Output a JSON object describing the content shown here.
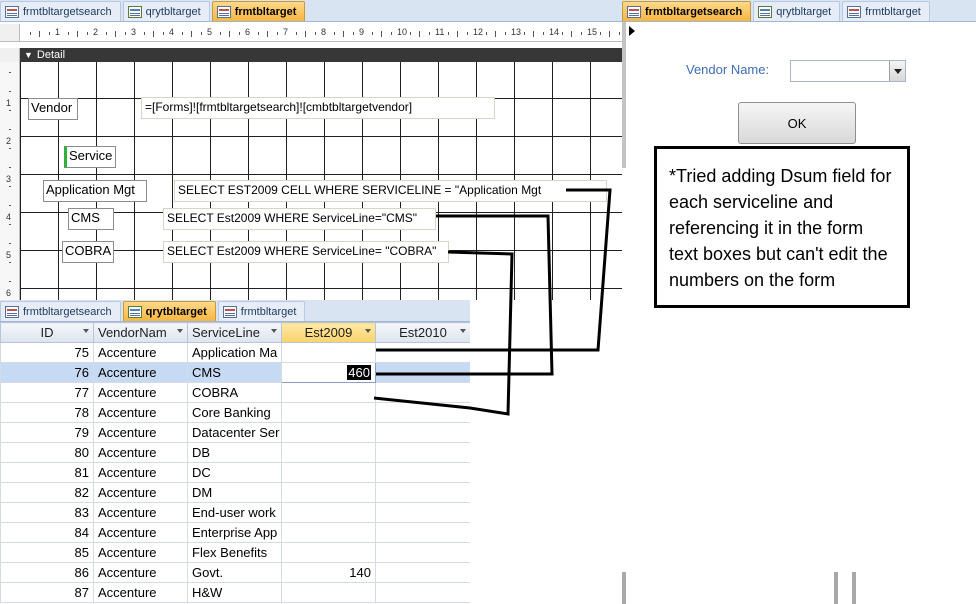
{
  "design_view": {
    "tabs": [
      {
        "label": "frmtbltargetsearch",
        "active": false
      },
      {
        "label": "qrytbltarget",
        "active": false
      },
      {
        "label": "frmtbltarget",
        "active": true
      }
    ],
    "section_label": "Detail",
    "ruler_numbers": [
      "1",
      "2",
      "3",
      "4",
      "5",
      "6",
      "7",
      "8",
      "9",
      "10",
      "11",
      "12",
      "13",
      "14",
      "15"
    ],
    "vertical_ruler_numbers": [
      "1",
      "2",
      "3",
      "4",
      "5",
      "6"
    ],
    "labels": {
      "vendor": "Vendor",
      "service": "Service",
      "application_mgt": "Application Mgt",
      "cms": "CMS",
      "cobra": "COBRA"
    },
    "textboxes": {
      "vendor_expr": "=[Forms]![frmtbltargetsearch]![cmbtbltargetvendor]",
      "application_mgt_query": "SELECT EST2009 CELL WHERE SERVICELINE = \"Application Mgt",
      "cms_query": "SELECT Est2009 WHERE ServiceLine=\"CMS\"",
      "cobra_query": "SELECT Est2009 WHERE ServiceLine= \"COBRA\""
    }
  },
  "datasheet": {
    "tabs": [
      {
        "label": "frmtbltargetsearch",
        "active": false
      },
      {
        "label": "qrytbltarget",
        "active": true
      },
      {
        "label": "frmtbltarget",
        "active": false
      }
    ],
    "columns": [
      "ID",
      "VendorNam",
      "ServiceLine",
      "Est2009",
      "Est2010"
    ],
    "rows": [
      {
        "id": "75",
        "vendor": "Accenture",
        "service": "Application Ma",
        "est2009": "",
        "est2010": ""
      },
      {
        "id": "76",
        "vendor": "Accenture",
        "service": "CMS",
        "est2009": "460",
        "est2010": ""
      },
      {
        "id": "77",
        "vendor": "Accenture",
        "service": "COBRA",
        "est2009": "",
        "est2010": ""
      },
      {
        "id": "78",
        "vendor": "Accenture",
        "service": "Core Banking",
        "est2009": "",
        "est2010": ""
      },
      {
        "id": "79",
        "vendor": "Accenture",
        "service": "Datacenter Ser",
        "est2009": "",
        "est2010": ""
      },
      {
        "id": "80",
        "vendor": "Accenture",
        "service": "DB",
        "est2009": "",
        "est2010": ""
      },
      {
        "id": "81",
        "vendor": "Accenture",
        "service": "DC",
        "est2009": "",
        "est2010": ""
      },
      {
        "id": "82",
        "vendor": "Accenture",
        "service": "DM",
        "est2009": "",
        "est2010": ""
      },
      {
        "id": "83",
        "vendor": "Accenture",
        "service": "End-user work",
        "est2009": "",
        "est2010": ""
      },
      {
        "id": "84",
        "vendor": "Accenture",
        "service": "Enterprise App",
        "est2009": "",
        "est2010": ""
      },
      {
        "id": "85",
        "vendor": "Accenture",
        "service": "Flex Benefits",
        "est2009": "",
        "est2010": ""
      },
      {
        "id": "86",
        "vendor": "Accenture",
        "service": "Govt.",
        "est2009": "140",
        "est2010": ""
      },
      {
        "id": "87",
        "vendor": "Accenture",
        "service": "H&W",
        "est2009": "",
        "est2010": ""
      }
    ]
  },
  "search_form": {
    "tabs": [
      {
        "label": "frmtbltargetsearch",
        "active": true
      },
      {
        "label": "qrytbltarget",
        "active": false
      },
      {
        "label": "frmtbltarget",
        "active": false
      }
    ],
    "vendor_label": "Vendor Name:",
    "vendor_value": "",
    "ok_label": "OK"
  },
  "annotation": {
    "note": "*Tried adding Dsum field for each serviceline and referencing it in the form text boxes but can't edit the numbers on the form"
  },
  "colors": {
    "active_tab": "#f7b53f",
    "tab_strip": "#d9e4f2",
    "selected_row": "#c7daf3",
    "label_blue": "#3f6db3"
  }
}
